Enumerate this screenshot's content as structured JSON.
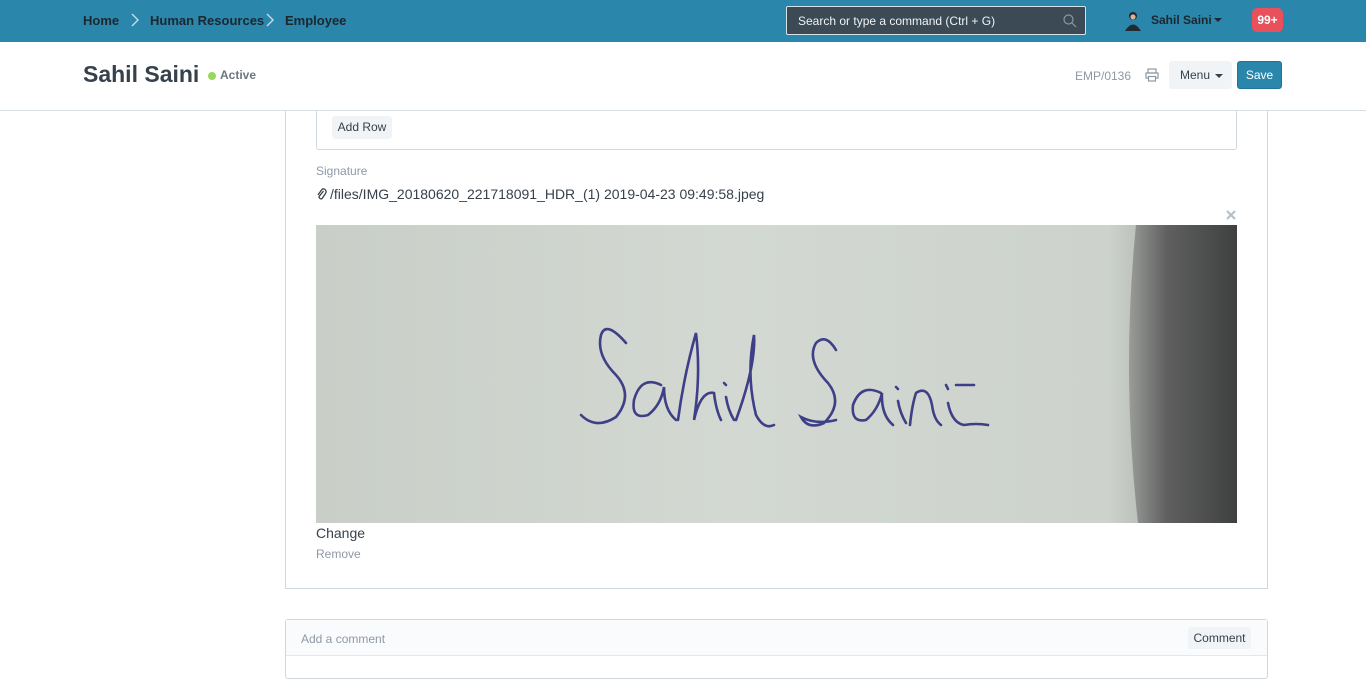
{
  "navbar": {
    "breadcrumbs": [
      "Home",
      "Human Resources",
      "Employee"
    ],
    "search_placeholder": "Search or type a command (Ctrl + G)",
    "user_name": "Sahil Saini",
    "notifications_count": "99+",
    "colors": {
      "bar": "#2a86aa",
      "badge": "#e8505b"
    }
  },
  "page_head": {
    "title": "Sahil Saini",
    "status": "Active",
    "status_color": "#98d85b",
    "doc_id": "EMP/0136",
    "menu_label": "Menu",
    "save_label": "Save"
  },
  "form": {
    "add_row_label": "Add Row",
    "signature_label": "Signature",
    "signature_file": "/files/IMG_20180620_221718091_HDR_(1) 2019-04-23 09:49:58.jpeg",
    "signature_handwriting": "Sahil Saini",
    "change_label": "Change",
    "remove_label": "Remove"
  },
  "comments": {
    "placeholder": "Add a comment",
    "button_label": "Comment"
  }
}
